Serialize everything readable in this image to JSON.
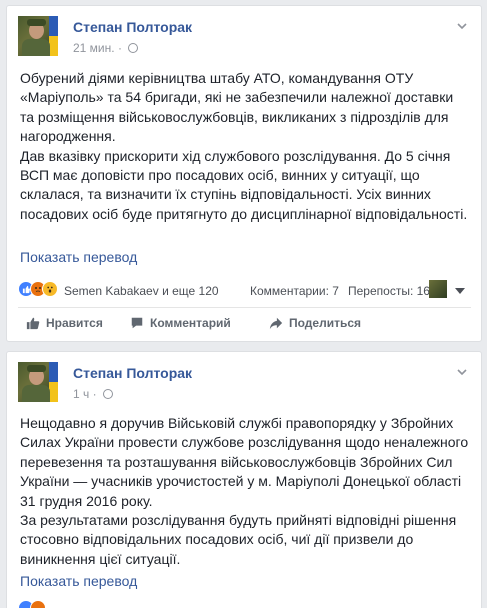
{
  "posts": [
    {
      "author": "Степан Полторак",
      "time": "21 мин.",
      "paragraphs": [
        "Обурений діями керівництва штабу АТО, командування ОТУ «Маріуполь» та 54 бригади, які не забезпечили належної доставки та розміщення військовослужбовців, викликаних з підрозділів для нагородження.",
        "Дав вказівку прискорити хід службового розслідування. До 5 січня ВСП має доповісти про посадових осіб, винних у ситуації, що склалася, та визначити їх ступінь відповідальності. Усіх винних посадових осіб буде притягнуто до дисциплінарної відповідальності."
      ],
      "translate_label": "Показать перевод",
      "reactions_text": "Semen Kabakaev и еще 120",
      "comments_text": "Комментарии: 7",
      "shares_text": "Перепосты: 16",
      "actions": {
        "like": "Нравится",
        "comment": "Комментарий",
        "share": "Поделиться"
      }
    },
    {
      "author": "Степан Полторак",
      "time": "1 ч",
      "paragraphs": [
        "Нещодавно я доручив Військовій службі правопорядку у Збройних Силах України провести службове розслідування щодо неналежного перевезення та розташування військовослужбовців Збройних Сил України — учасників урочистостей у м. Маріуполі Донецької області 31 грудня 2016 року.",
        "За результатами розслідування будуть прийняті відповідні рішення стосовно відповідальних посадових осіб, чиї дії призвели до виникнення цієї ситуації."
      ],
      "translate_label": "Показать перевод"
    }
  ],
  "icons": {
    "like": "like-icon",
    "angry": "angry-icon",
    "wow": "wow-icon",
    "globe": "globe-icon",
    "menu": "chevron-down-icon"
  },
  "colors": {
    "link": "#365899",
    "like_reaction": "#4080ff",
    "angry_reaction": "#e9710f",
    "wow_reaction": "#f7b928",
    "background": "#e9ebee"
  }
}
